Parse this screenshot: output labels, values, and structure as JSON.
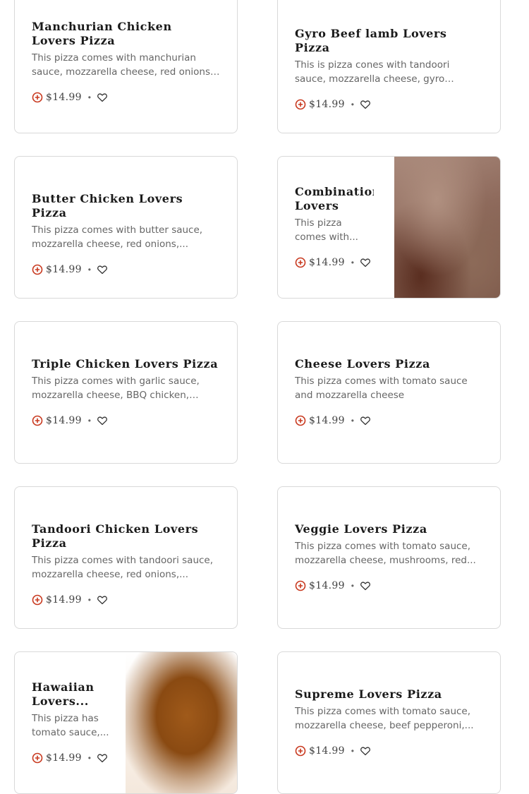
{
  "colors": {
    "accent": "#c8391f",
    "border": "#d9d9d9"
  },
  "icons": {
    "add": "add-circle-icon",
    "favorite": "heart-outline-icon"
  },
  "price_separator": "•",
  "items": [
    {
      "title": "Manchurian Chicken Lovers Pizza",
      "description": "This pizza comes with manchurian sauce, mozzarella cheese, red onions l,...",
      "price": "$14.99"
    },
    {
      "title": "Gyro Beef lamb Lovers Pizza",
      "description": "This is pizza cones with tandoori sauce, mozzarella cheese, gyro beef/lamb, re...",
      "price": "$14.99"
    },
    {
      "title": "Butter Chicken Lovers Pizza",
      "description": "This pizza comes with butter sauce, mozzarella cheese, red onions,...",
      "price": "$14.99"
    },
    {
      "title": "Combination Lovers Pizza",
      "description": "This pizza comes with...",
      "price": "$14.99"
    },
    {
      "title": "Triple Chicken Lovers Pizza",
      "description": "This pizza comes with garlic sauce, mozzarella cheese, BBQ chicken, buffal...",
      "price": "$14.99"
    },
    {
      "title": "Cheese Lovers Pizza",
      "description": "This pizza comes with tomato sauce and mozzarella cheese",
      "price": "$14.99"
    },
    {
      "title": "Tandoori Chicken Lovers Pizza",
      "description": "This pizza comes with tandoori sauce, mozzarella cheese, red onions,...",
      "price": "$14.99"
    },
    {
      "title": "Veggie Lovers Pizza",
      "description": "This pizza comes with tomato sauce, mozzarella cheese, mushrooms, red...",
      "price": "$14.99"
    },
    {
      "title": "Hawaiian Lovers...",
      "description": "This pizza has tomato sauce,...",
      "price": "$14.99"
    },
    {
      "title": "Supreme Lovers Pizza",
      "description": "This pizza comes with tomato sauce, mozzarella cheese, beef pepperoni,...",
      "price": "$14.99"
    }
  ]
}
